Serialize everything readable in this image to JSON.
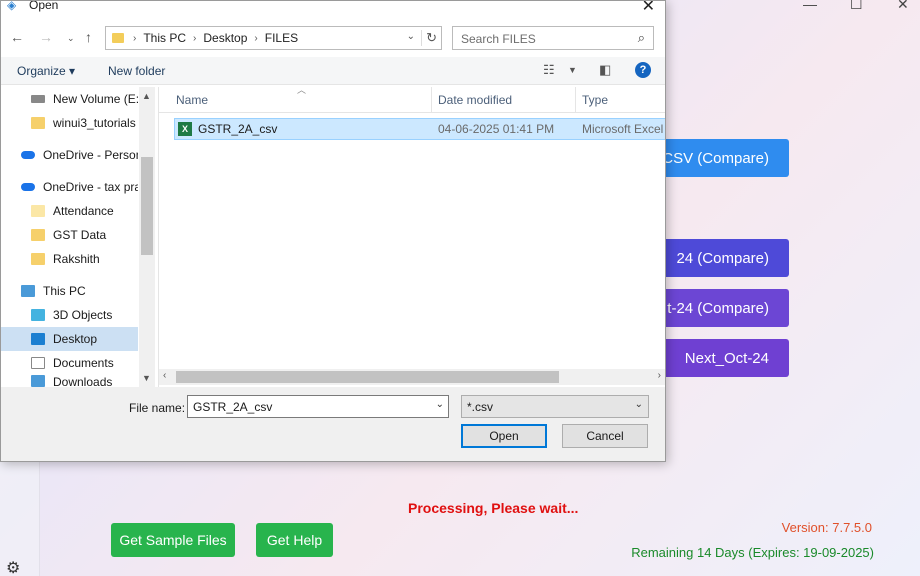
{
  "app": {
    "buttons": [
      {
        "label": "CSV (Compare)"
      },
      {
        "label": "24 (Compare)"
      },
      {
        "label": "t-24 (Compare)"
      },
      {
        "label": "Next_Oct-24"
      }
    ],
    "processing": "Processing, Please wait...",
    "sample_btn": "Get Sample Files",
    "help_btn": "Get Help",
    "version": "Version: 7.7.5.0",
    "remaining": "Remaining 14 Days (Expires: 19-09-2025)",
    "icons": [
      "minimize-icon",
      "maximize-icon",
      "close-icon",
      "settings-gear-icon"
    ]
  },
  "dialog": {
    "title": "Open",
    "address": {
      "crumbs": [
        "This PC",
        "Desktop",
        "FILES"
      ]
    },
    "search_placeholder": "Search FILES",
    "toolbar": {
      "organize": "Organize ▾",
      "new_folder": "New folder"
    },
    "nav_items": [
      {
        "label": "New Volume (E:)",
        "icon": "drive-icon"
      },
      {
        "label": "winui3_tutorials",
        "icon": "folder-icon"
      },
      {
        "label": "OneDrive - Person",
        "icon": "onedrive-icon"
      },
      {
        "label": "OneDrive - tax pra",
        "icon": "onedrive-icon"
      },
      {
        "label": "Attendance",
        "icon": "folder-icon"
      },
      {
        "label": "GST Data",
        "icon": "folder-icon"
      },
      {
        "label": "Rakshith",
        "icon": "folder-icon"
      },
      {
        "label": "This PC",
        "icon": "pc-icon"
      },
      {
        "label": "3D Objects",
        "icon": "3d-objects-icon"
      },
      {
        "label": "Desktop",
        "icon": "desktop-icon",
        "selected": true
      },
      {
        "label": "Documents",
        "icon": "documents-icon"
      },
      {
        "label": "Downloads",
        "icon": "downloads-icon"
      }
    ],
    "columns": {
      "name": "Name",
      "date": "Date modified",
      "type": "Type"
    },
    "files": [
      {
        "name": "GSTR_2A_csv",
        "date": "04-06-2025 01:41 PM",
        "type": "Microsoft Excel",
        "icon": "excel-icon"
      }
    ],
    "file_name_label": "File name:",
    "file_name_value": "GSTR_2A_csv",
    "filter_value": "*.csv",
    "open_label": "Open",
    "cancel_label": "Cancel"
  }
}
